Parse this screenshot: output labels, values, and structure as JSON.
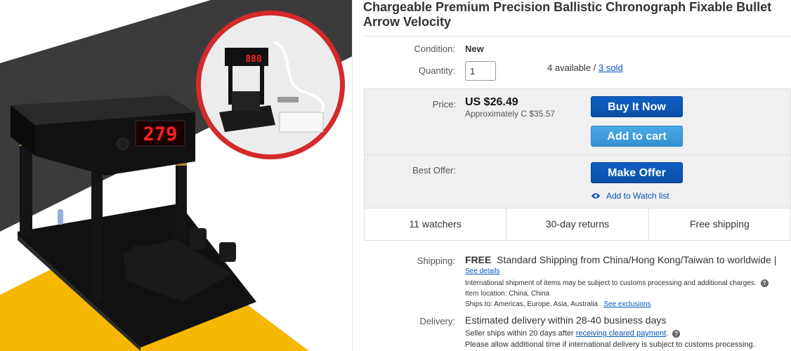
{
  "product": {
    "title": "Chargeable Premium Precision Ballistic Chronograph Fixable Bullet Arrow Velocity",
    "display_reading": "279",
    "inset_display_reading": "888"
  },
  "condition": {
    "label": "Condition:",
    "value": "New"
  },
  "quantity": {
    "label": "Quantity:",
    "value": "1",
    "available": "4 available / ",
    "sold_link": "3 sold"
  },
  "price": {
    "label": "Price:",
    "amount": "US $26.49",
    "approx": "Approximately C $35.57"
  },
  "buttons": {
    "buy_now": "Buy It Now",
    "add_to_cart": "Add to cart",
    "make_offer": "Make Offer"
  },
  "best_offer": {
    "label": "Best Offer:"
  },
  "watch": {
    "label": "Add to Watch list",
    "icon": "eye-icon"
  },
  "stats": {
    "watchers": "11 watchers",
    "returns": "30-day returns",
    "shipping": "Free shipping"
  },
  "shipping": {
    "label": "Shipping:",
    "free": "FREE",
    "desc": "Standard Shipping from China/Hong Kong/Taiwan to worldwide |",
    "details_link": "See details",
    "intl_note": "International shipment of items may be subject to customs processing and additional charges.",
    "location": "Item location:  China, China",
    "ships_to": "Ships to:  Americas, Europe, Asia, Australia",
    "exclusions_link": "See exclusions"
  },
  "delivery": {
    "label": "Delivery:",
    "estimate": "Estimated delivery within 28-40 business days",
    "seller_ships": "Seller ships within 20 days after ",
    "payment_link": "receiving cleared payment",
    "allow_time": "Please allow additional time if international delivery is subject to customs processing."
  },
  "colors": {
    "link": "#0654ba",
    "primary_button": "#0a4fa6",
    "secondary_button": "#3591d2",
    "image_accent_yellow": "#f5b700",
    "image_accent_gray": "#3b3b3b",
    "inset_ring": "#d42a2a",
    "led_red": "#ff2020"
  }
}
